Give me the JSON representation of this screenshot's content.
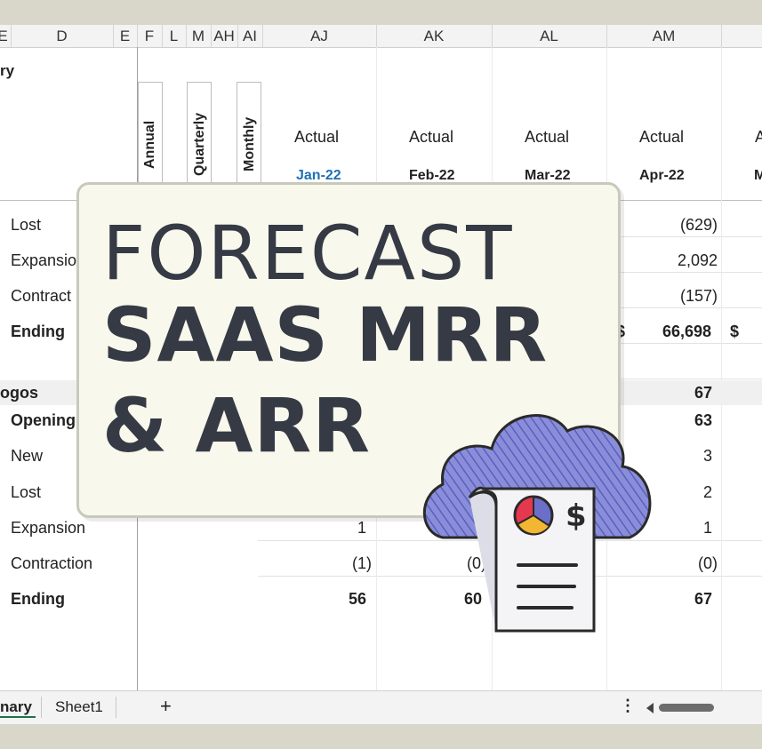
{
  "columns": [
    "E",
    "D",
    "E",
    "F",
    "L",
    "M",
    "AH",
    "AI",
    "AJ",
    "AK",
    "AL",
    "AM"
  ],
  "summary_label": "ry",
  "period_headers": [
    "Annual",
    "Quarterly",
    "Monthly"
  ],
  "actual_labels": [
    "Actual",
    "Actual",
    "Actual",
    "Actual",
    "A"
  ],
  "months": [
    "Jan-22",
    "Feb-22",
    "Mar-22",
    "Apr-22",
    "M"
  ],
  "rows_mrr": {
    "lost": "Lost",
    "expansion": "Expansio",
    "contraction": "Contract",
    "ending": "Ending",
    "values_am": [
      "(629)",
      "2,092",
      "(157)",
      "66,698"
    ],
    "dollar1": "$",
    "dollar2": "$"
  },
  "rows_logos": {
    "section": "ogos",
    "opening": "Opening",
    "new": "New",
    "lost": "Lost",
    "expansion": "Expansion",
    "contraction": "Contraction",
    "ending": "Ending",
    "am": [
      "67",
      "63",
      "3",
      "2",
      "1",
      "(0)",
      "67"
    ],
    "aj": [
      "1",
      "(1)",
      "56"
    ],
    "ak": [
      "(0)",
      "60"
    ]
  },
  "tabs": [
    "nary",
    "Sheet1",
    "+"
  ],
  "tab_menu_icon": "more-vertical-icon",
  "scroll_left_icon": "caret-left-icon",
  "title": {
    "line1": "FORECAST",
    "line2": "SAAS MRR",
    "line3": "& ARR"
  },
  "icon": "cloud-invoice-icon",
  "icon_symbol": "$",
  "colors": {
    "title_text": "#363a45",
    "card_bg": "#f8f8ec",
    "month_blue": "#1f6fb3",
    "cloud": "#6b6fc7",
    "pie_red": "#e5384f",
    "pie_yellow": "#f2b632",
    "pie_purple": "#6b6fc7"
  }
}
